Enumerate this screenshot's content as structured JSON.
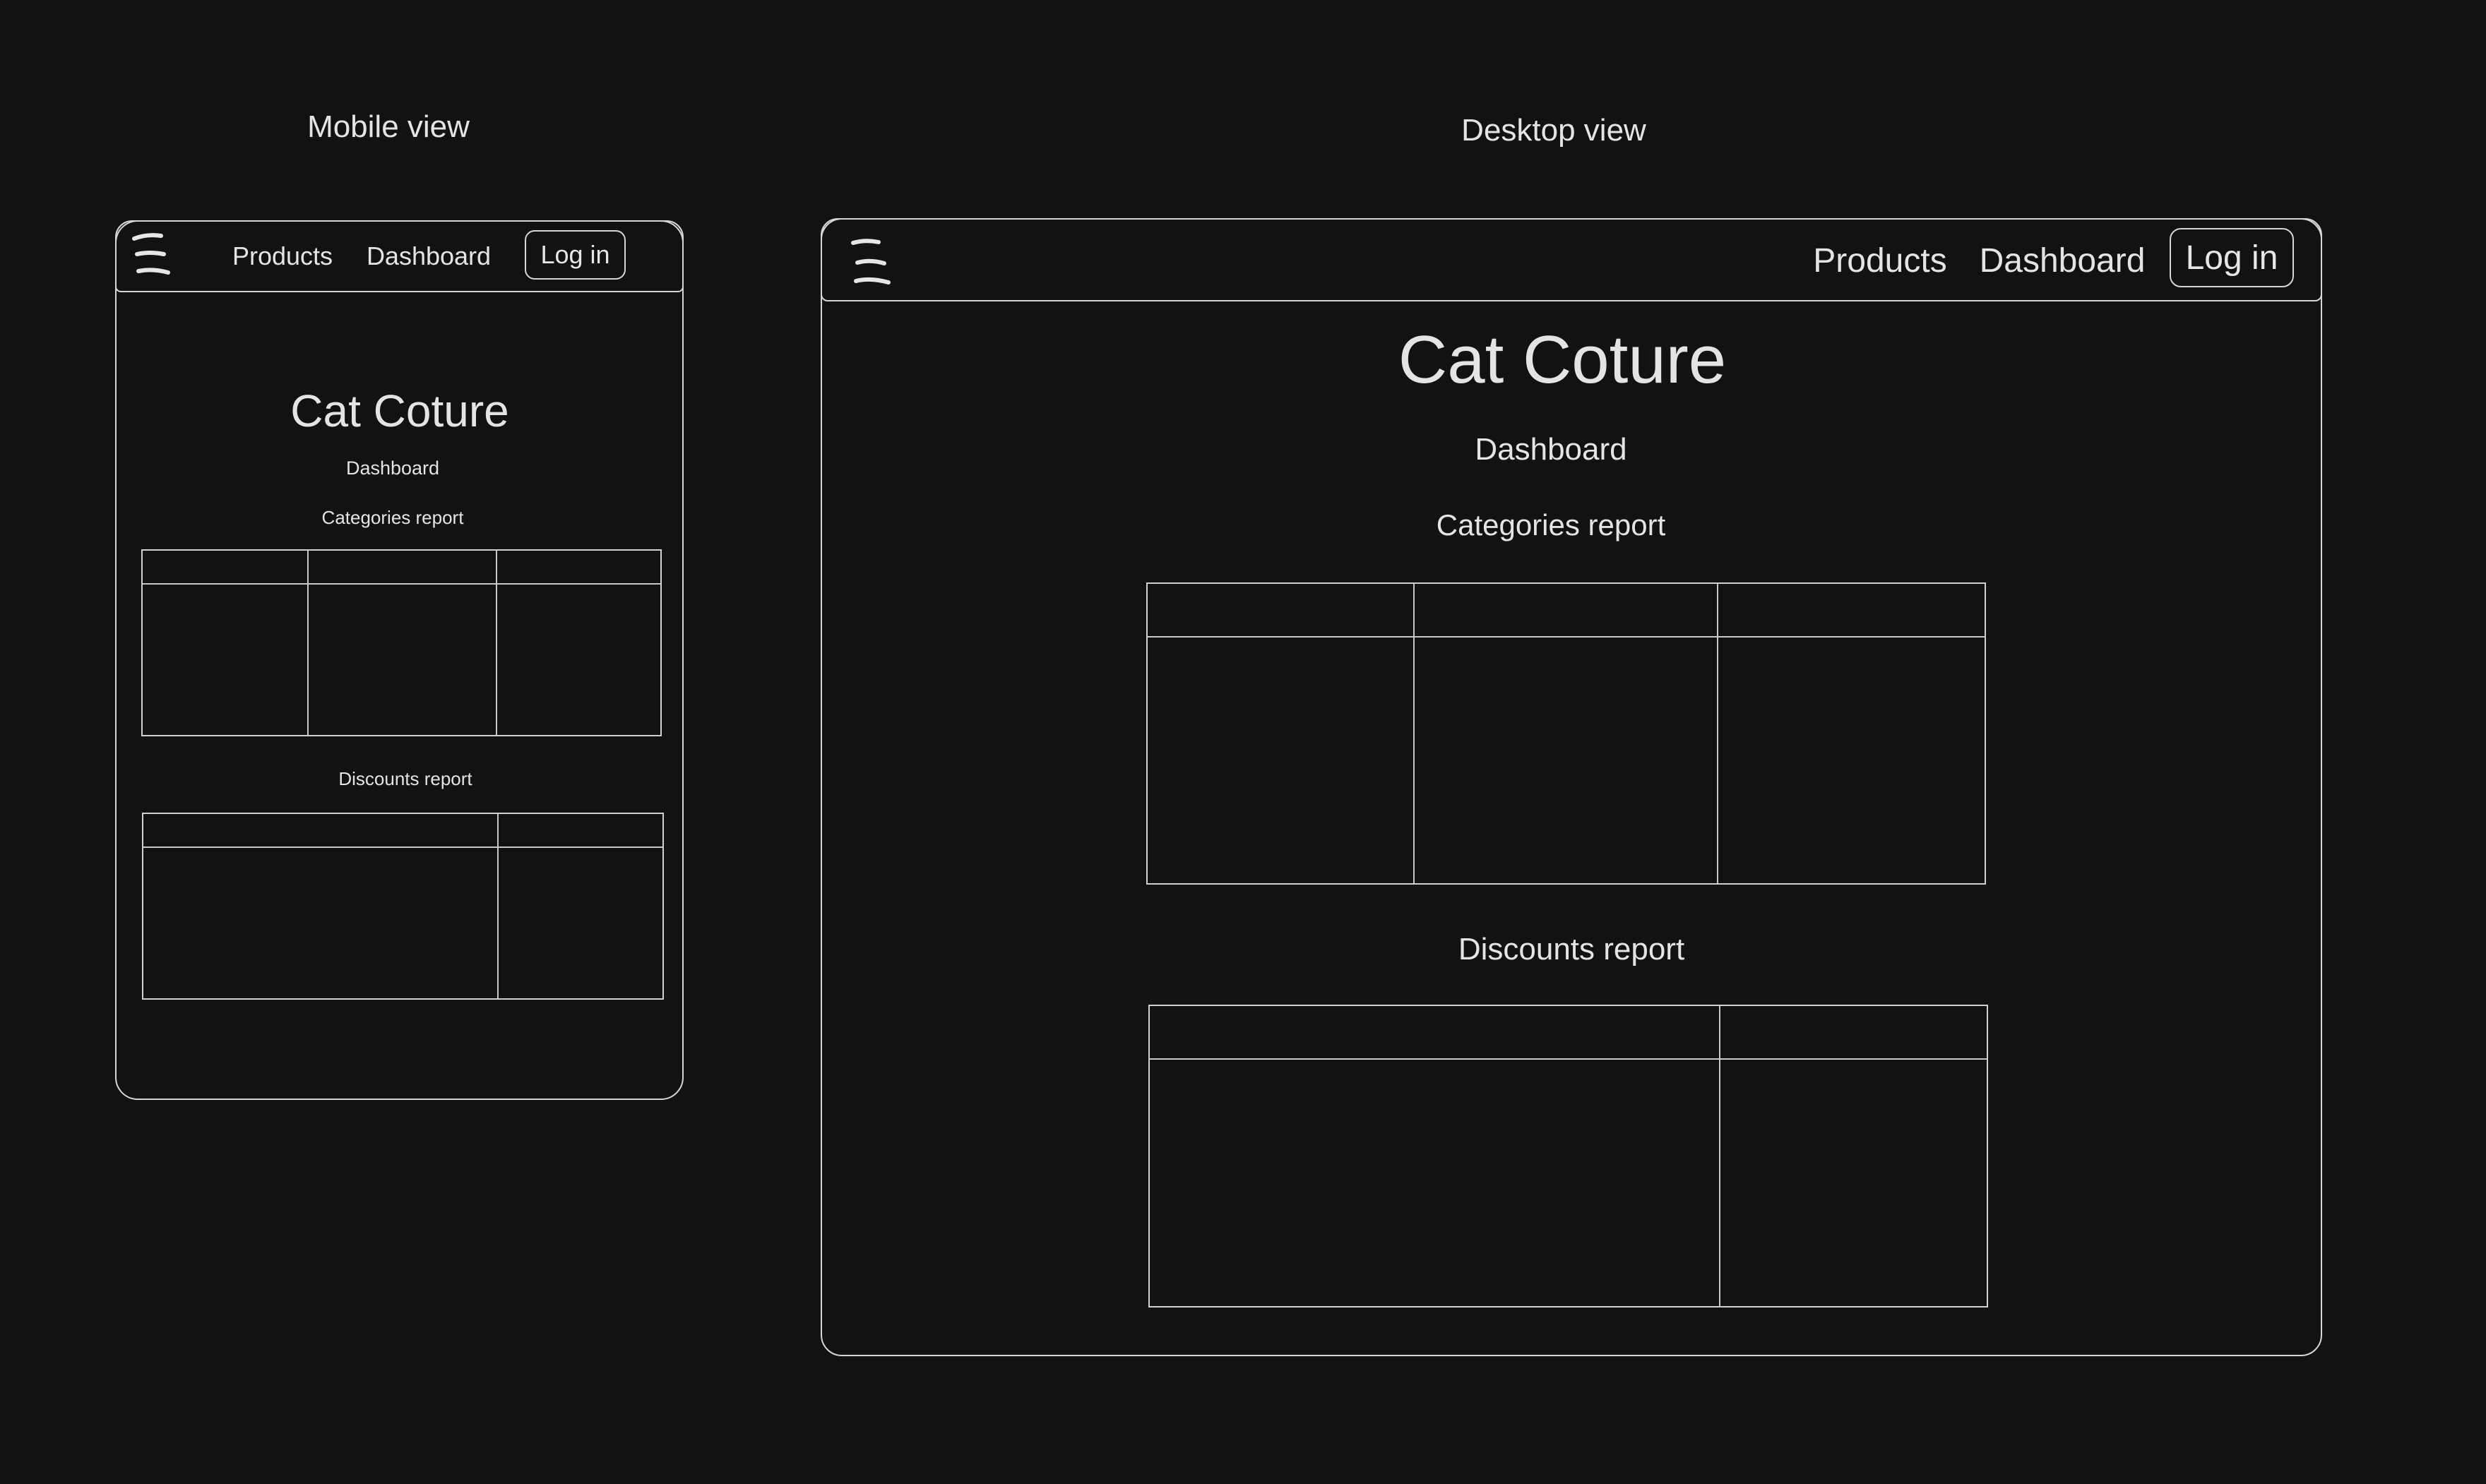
{
  "mobile": {
    "view_label": "Mobile view",
    "nav": {
      "products": "Products",
      "dashboard": "Dashboard",
      "login": "Log in"
    },
    "title": "Cat Coture",
    "subtitle": "Dashboard",
    "categories_report": "Categories report",
    "discounts_report": "Discounts report"
  },
  "desktop": {
    "view_label": "Desktop view",
    "nav": {
      "products": "Products",
      "dashboard": "Dashboard",
      "login": "Log in"
    },
    "title": "Cat Coture",
    "subtitle": "Dashboard",
    "categories_report": "Categories report",
    "discounts_report": "Discounts report"
  },
  "colors": {
    "background": "#121212",
    "stroke": "#d6d6d6",
    "text": "#e6e6e6"
  },
  "icons": {
    "menu": "hamburger-menu-icon"
  }
}
